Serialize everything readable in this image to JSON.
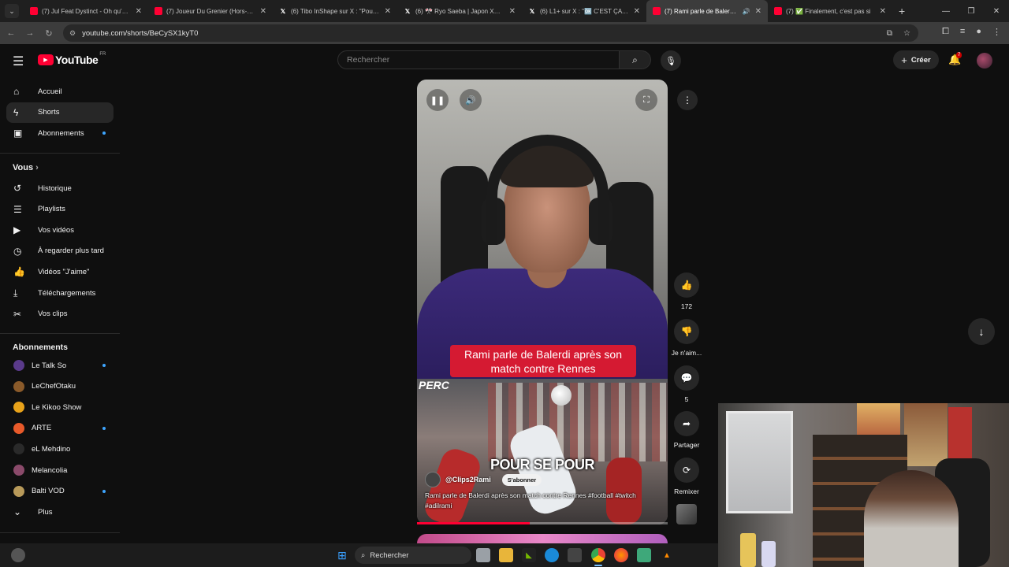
{
  "browser": {
    "tabs": [
      {
        "title": "(7) Jul Feat Dystinct - Oh qu'elle",
        "icon": "youtube-favicon",
        "active": false
      },
      {
        "title": "(7) Joueur Du Grenier (Hors-séri",
        "icon": "youtube-favicon",
        "active": false
      },
      {
        "title": "(6) Tibo InShape sur X : \"Pour s",
        "icon": "x-favicon",
        "active": false
      },
      {
        "title": "(6) 🎌 Ryo Saeba | Japon XYZ 🎌",
        "icon": "x-favicon",
        "active": false
      },
      {
        "title": "(6) L1+ sur X : \"🆗 C'EST ÇA @",
        "icon": "x-favicon",
        "active": false
      },
      {
        "title": "(7) Rami parle de Balerdi a",
        "icon": "youtube-favicon",
        "active": true
      },
      {
        "title": "(7) ✅ Finalement, c'est pas si",
        "icon": "youtube-favicon",
        "active": false
      }
    ],
    "url": "youtube.com/shorts/BeCySX1kyT0"
  },
  "header": {
    "logo_text": "YouTube",
    "country": "FR",
    "search_placeholder": "Rechercher",
    "create_label": "Créer",
    "notification_count": "7"
  },
  "sidebar": {
    "main": [
      {
        "label": "Accueil",
        "icon": "home-icon"
      },
      {
        "label": "Shorts",
        "icon": "shorts-icon"
      },
      {
        "label": "Abonnements",
        "icon": "subscriptions-icon"
      }
    ],
    "you_heading": "Vous",
    "you_items": [
      {
        "label": "Historique",
        "icon": "history-icon"
      },
      {
        "label": "Playlists",
        "icon": "playlists-icon"
      },
      {
        "label": "Vos vidéos",
        "icon": "your-videos-icon"
      },
      {
        "label": "À regarder plus tard",
        "icon": "watch-later-icon"
      },
      {
        "label": "Vidéos \"J'aime\"",
        "icon": "liked-icon"
      },
      {
        "label": "Téléchargements",
        "icon": "download-icon"
      },
      {
        "label": "Vos clips",
        "icon": "clips-icon"
      }
    ],
    "subs_heading": "Abonnements",
    "subscriptions": [
      {
        "label": "Le Talk So",
        "color": "#5a3a8a"
      },
      {
        "label": "LeChefOtaku",
        "color": "#8a5a2a"
      },
      {
        "label": "Le Kikoo Show",
        "color": "#e8a21a"
      },
      {
        "label": "ARTE",
        "color": "#e85a2a"
      },
      {
        "label": "eL Mehdino",
        "color": "#2a2a2a"
      },
      {
        "label": "Melancolia",
        "color": "#8a4a6a"
      },
      {
        "label": "Balti VOD",
        "color": "#b89a5a"
      }
    ],
    "more_label": "Plus"
  },
  "short": {
    "caption": "Rami parle de Balerdi après son match contre Rennes",
    "subtitle": "POUR SE POUR",
    "image_text": "PERC",
    "channel": "@Clips2Rami",
    "subscribe_label": "S'abonner",
    "description": "Rami parle de Balerdi après son match contre Rennes #football #twitch #adilrami",
    "progress": 0.45
  },
  "actions": {
    "likes": "172",
    "dislike_label": "Je n'aim...",
    "comments": "5",
    "share_label": "Partager",
    "remix_label": "Remixer"
  },
  "taskbar": {
    "search_label": "Rechercher"
  }
}
